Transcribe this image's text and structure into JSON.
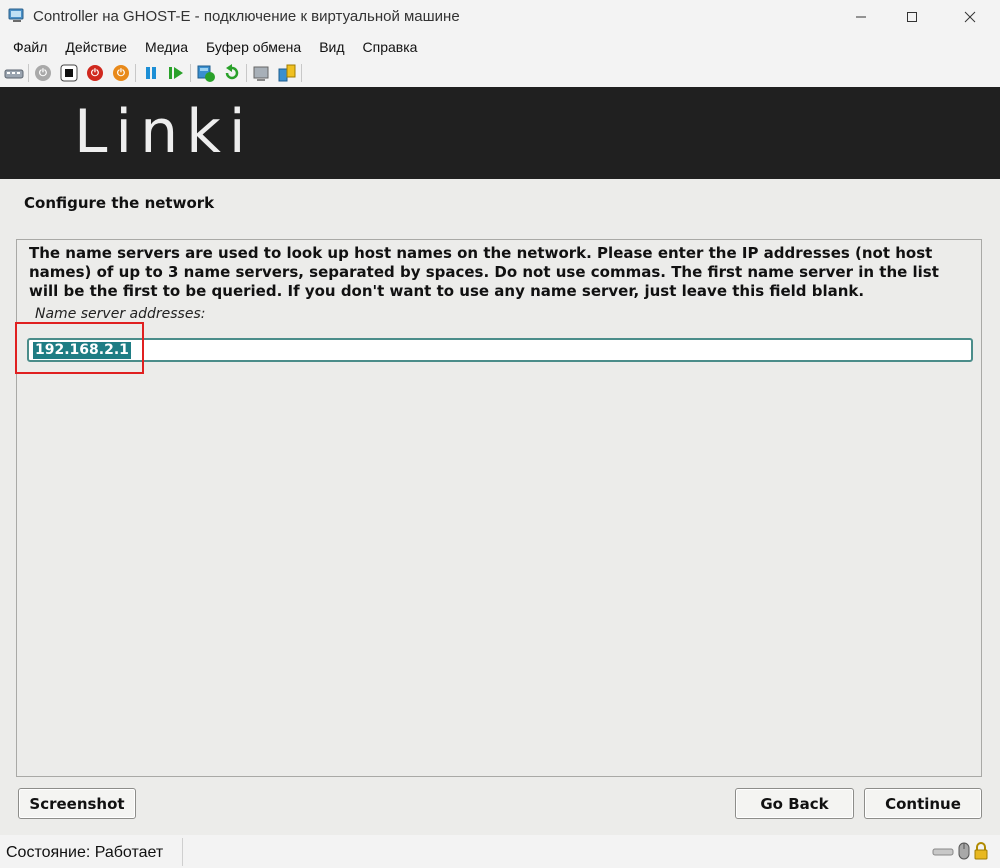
{
  "window": {
    "title": "Controller на GHOST-E - подключение к виртуальной машине"
  },
  "menu": {
    "items": [
      "Файл",
      "Действие",
      "Медиа",
      "Буфер обмена",
      "Вид",
      "Справка"
    ]
  },
  "toolbar": {
    "buttons": [
      "ctrl-alt-del-icon",
      "start-icon",
      "turn-off-icon",
      "shutdown-icon",
      "power-icon",
      "pause-icon",
      "play-icon",
      "checkpoint-icon",
      "revert-icon",
      "enhanced-session-icon",
      "share-icon"
    ]
  },
  "installer": {
    "logo": "Linki",
    "page_title": "Configure the network",
    "description": "The name servers are used to look up host names on the network. Please enter the IP addresses (not host names) of up to 3 name servers, separated by spaces. Do not use commas. The first name server in the list will be the first to be queried. If you don't want to use any name server, just leave this field blank.",
    "field_label": "Name server addresses:",
    "name_servers_value": "192.168.2.1",
    "buttons": {
      "screenshot": "Screenshot",
      "go_back": "Go Back",
      "continue": "Continue"
    }
  },
  "status": {
    "text": "Состояние: Работает"
  },
  "colors": {
    "selection": "#1f7d84",
    "input_border": "#4b8d8a",
    "highlight": "#e02020",
    "banner": "#202020"
  }
}
